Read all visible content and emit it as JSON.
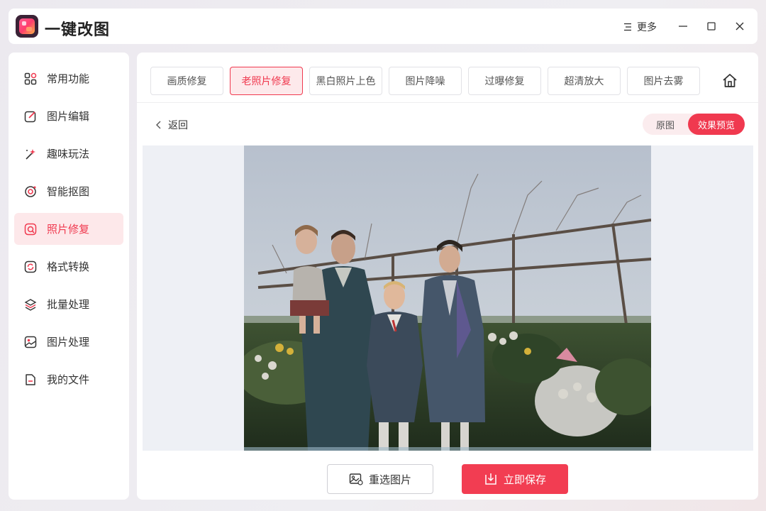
{
  "app": {
    "title": "一键改图",
    "more_label": "更多"
  },
  "sidebar": {
    "items": [
      {
        "label": "常用功能",
        "icon": "grid-icon"
      },
      {
        "label": "图片编辑",
        "icon": "edit-icon"
      },
      {
        "label": "趣味玩法",
        "icon": "magic-wand-icon"
      },
      {
        "label": "智能抠图",
        "icon": "target-icon"
      },
      {
        "label": "照片修复",
        "icon": "photo-repair-icon",
        "active": true
      },
      {
        "label": "格式转换",
        "icon": "convert-icon"
      },
      {
        "label": "批量处理",
        "icon": "layers-icon"
      },
      {
        "label": "图片处理",
        "icon": "image-icon"
      },
      {
        "label": "我的文件",
        "icon": "file-icon"
      }
    ]
  },
  "tabs": [
    {
      "label": "画质修复"
    },
    {
      "label": "老照片修复",
      "active": true
    },
    {
      "label": "黑白照片上色"
    },
    {
      "label": "图片降噪"
    },
    {
      "label": "过曝修复"
    },
    {
      "label": "超清放大"
    },
    {
      "label": "图片去雾"
    }
  ],
  "toolbar": {
    "back_label": "返回"
  },
  "view_toggle": {
    "original_label": "原图",
    "preview_label": "效果预览",
    "selected": "效果预览"
  },
  "actions": {
    "reselect_label": "重选图片",
    "save_label": "立即保存"
  },
  "colors": {
    "accent": "#f0394f",
    "active_bg": "#fde8ea",
    "preview_bg": "#eef0f5"
  }
}
